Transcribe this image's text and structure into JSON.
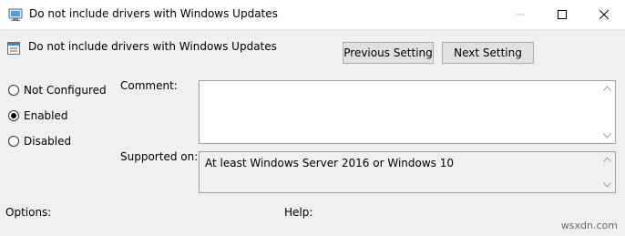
{
  "window": {
    "title": "Do not include drivers with Windows Updates",
    "icons": {
      "title": "policy-icon",
      "minimize": "minimize-icon",
      "maximize": "maximize-icon",
      "close": "close-icon"
    }
  },
  "header": {
    "setting_name": "Do not include drivers with Windows Updates",
    "icon": "setting-icon"
  },
  "buttons": {
    "previous": "Previous Setting",
    "next": "Next Setting"
  },
  "state": {
    "options": [
      {
        "label": "Not Configured",
        "checked": false
      },
      {
        "label": "Enabled",
        "checked": true
      },
      {
        "label": "Disabled",
        "checked": false
      }
    ]
  },
  "comment": {
    "label": "Comment:",
    "value": ""
  },
  "supported": {
    "label": "Supported on:",
    "value": "At least Windows Server 2016 or Windows 10"
  },
  "sections": {
    "options_label": "Options:",
    "help_label": "Help:"
  },
  "watermark": "wsxdn.com",
  "colors": {
    "title_bar": "#ffffff",
    "dialog_bg": "#f0f0f0",
    "button_bg": "#e1e1e1",
    "button_border": "#adadad"
  }
}
